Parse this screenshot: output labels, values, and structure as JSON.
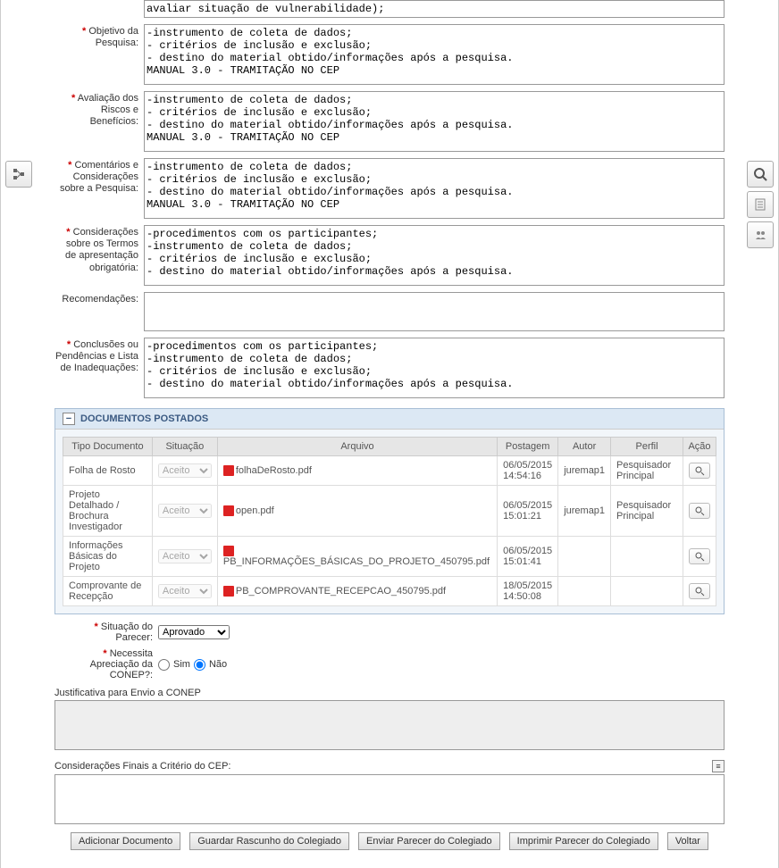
{
  "fields": {
    "objetivo": {
      "label": "Objetivo da Pesquisa:",
      "text": "-instrumento de coleta de dados;\n- critérios de inclusão e exclusão;\n- destino do material obtido/informações após a pesquisa.\nMANUAL 3.0 - TRAMITAÇÃO NO CEP"
    },
    "avaliacao": {
      "label": "Avaliação dos Riscos e Benefícios:",
      "text": "-instrumento de coleta de dados;\n- critérios de inclusão e exclusão;\n- destino do material obtido/informações após a pesquisa.\nMANUAL 3.0 - TRAMITAÇÃO NO CEP"
    },
    "comentarios": {
      "label": "Comentários e Considerações sobre a Pesquisa:",
      "text": "-instrumento de coleta de dados;\n- critérios de inclusão e exclusão;\n- destino do material obtido/informações após a pesquisa.\nMANUAL 3.0 - TRAMITAÇÃO NO CEP"
    },
    "termos": {
      "label": "Considerações sobre os Termos de apresentação obrigatória:",
      "text": "-procedimentos com os participantes;\n-instrumento de coleta de dados;\n- critérios de inclusão e exclusão;\n- destino do material obtido/informações após a pesquisa."
    },
    "recomendacoes": {
      "label": "Recomendações:",
      "text": ""
    },
    "conclusoes": {
      "label": "Conclusões ou Pendências e Lista de Inadequações:",
      "text": "-procedimentos com os participantes;\n-instrumento de coleta de dados;\n- critérios de inclusão e exclusão;\n- destino do material obtido/informações após a pesquisa."
    },
    "intro_partial": "avaliar situação de vulnerabilidade);"
  },
  "docs_panel": {
    "title": "DOCUMENTOS POSTADOS"
  },
  "table": {
    "headers": {
      "tipo": "Tipo Documento",
      "situacao": "Situação",
      "arquivo": "Arquivo",
      "postagem": "Postagem",
      "autor": "Autor",
      "perfil": "Perfil",
      "acao": "Ação"
    },
    "situacao_option": "Aceito",
    "rows": [
      {
        "tipo": "Folha de Rosto",
        "arquivo": "folhaDeRosto.pdf",
        "postagem": "06/05/2015 14:54:16",
        "autor": "juremap1",
        "perfil": "Pesquisador Principal"
      },
      {
        "tipo": "Projeto Detalhado / Brochura Investigador",
        "arquivo": "open.pdf",
        "postagem": "06/05/2015 15:01:21",
        "autor": "juremap1",
        "perfil": "Pesquisador Principal"
      },
      {
        "tipo": "Informações Básicas do Projeto",
        "arquivo": "PB_INFORMAÇÕES_BÁSICAS_DO_PROJETO_450795.pdf",
        "postagem": "06/05/2015 15:01:41",
        "autor": "",
        "perfil": ""
      },
      {
        "tipo": "Comprovante de Recepção",
        "arquivo": "PB_COMPROVANTE_RECEPCAO_450795.pdf",
        "postagem": "18/05/2015 14:50:08",
        "autor": "",
        "perfil": ""
      }
    ]
  },
  "form": {
    "situacao_label": "Situação do Parecer:",
    "situacao_value": "Aprovado",
    "conep_label": "Necessita Apreciação da CONEP?:",
    "sim": "Sim",
    "nao": "Não",
    "justificativa_label": "Justificativa para Envio a CONEP",
    "consideracoes_label": "Considerações Finais a Critério do CEP:"
  },
  "buttons": {
    "adicionar": "Adicionar Documento",
    "guardar": "Guardar Rascunho do Colegiado",
    "enviar": "Enviar Parecer do Colegiado",
    "imprimir": "Imprimir Parecer do Colegiado",
    "voltar": "Voltar"
  }
}
